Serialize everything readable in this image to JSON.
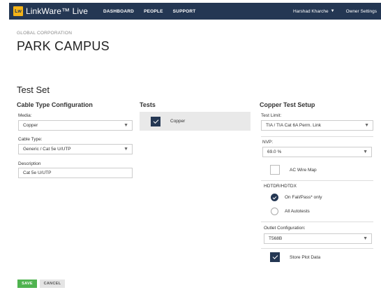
{
  "nav": {
    "logo_mark": "Lw",
    "logo_text": "LinkWare™ Live",
    "links": [
      "DASHBOARD",
      "PEOPLE",
      "SUPPORT"
    ],
    "user": "Harshad Kharche",
    "owner_settings": "Owner Settings"
  },
  "page": {
    "org": "GLOBAL CORPORATION",
    "campus": "PARK CAMPUS",
    "section": "Test Set"
  },
  "cable": {
    "heading": "Cable Type Configuration",
    "media_label": "Media:",
    "media_value": "Copper",
    "type_label": "Cable Type:",
    "type_value": "Generic / Cat 5e U/UTP",
    "desc_label": "Description",
    "desc_value": "Cat 5e U/UTP"
  },
  "tests": {
    "heading": "Tests",
    "items": [
      {
        "label": "Copper",
        "checked": true
      }
    ]
  },
  "copper": {
    "heading": "Copper Test Setup",
    "limit_label": "Test Limit:",
    "limit_value": "TIA / TIA Cat 6A Perm. Link",
    "nvp_label": "NVP:",
    "nvp_value": "69.0 %",
    "ac_wire_map": "AC Wire Map",
    "hdtdr_label": "HDTDR/HDTDX",
    "opt_fail": "On Fail/Pass* only",
    "opt_all": "All Autotests",
    "outlet_label": "Outlet Configuration:",
    "outlet_value": "T568B",
    "store_plot": "Store Plot Data"
  },
  "actions": {
    "save": "SAVE",
    "cancel": "CANCEL"
  },
  "colors": {
    "navbar": "#243753",
    "accent": "#f5b417",
    "save": "#4fb34f"
  }
}
